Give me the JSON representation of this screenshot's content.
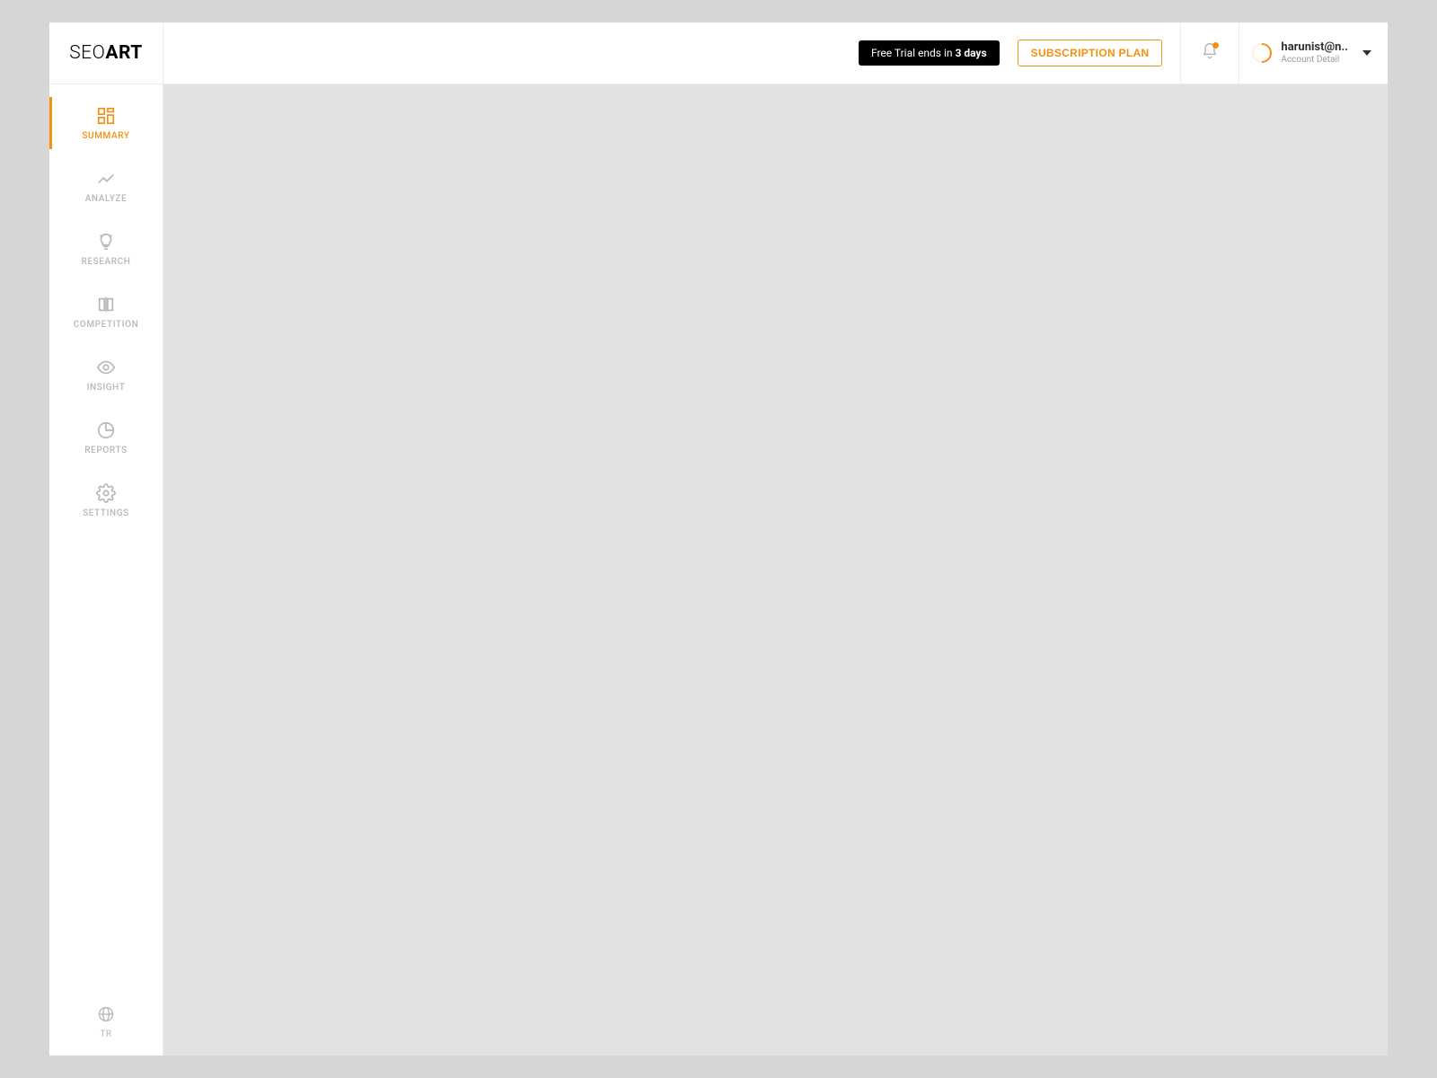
{
  "brand": {
    "part1": "SEO",
    "part2": "ART"
  },
  "header": {
    "trial_prefix": "Free Trial ends in ",
    "trial_days": "3 days",
    "subscription_label": "SUBSCRIPTION PLAN",
    "account_name": "harunist@n..",
    "account_sub": "Account Detail"
  },
  "sidebar": {
    "items": [
      {
        "label": "SUMMARY"
      },
      {
        "label": "ANALYZE"
      },
      {
        "label": "RESEARCH"
      },
      {
        "label": "COMPETITION"
      },
      {
        "label": "INSIGHT"
      },
      {
        "label": "REPORTS"
      },
      {
        "label": "SETTINGS"
      }
    ],
    "language": "TR"
  },
  "colors": {
    "accent": "#f29111"
  }
}
